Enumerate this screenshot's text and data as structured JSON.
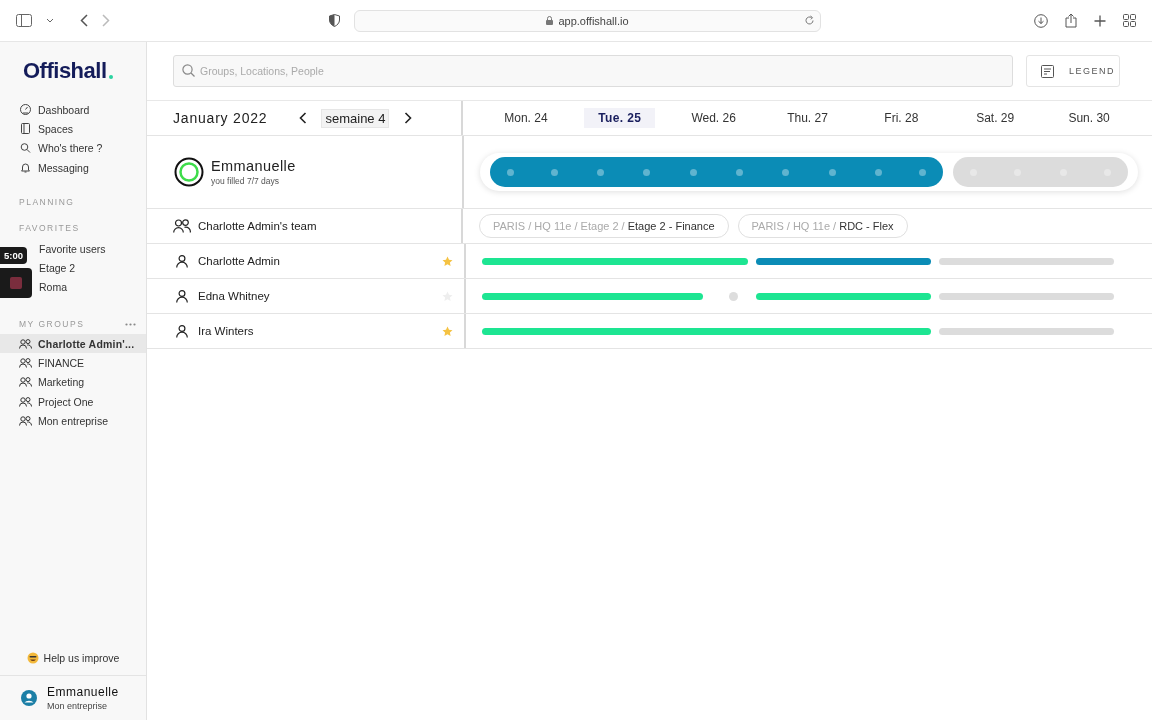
{
  "browser": {
    "url": "app.offishall.io"
  },
  "sidebar": {
    "logo": "Offishall",
    "nav": [
      {
        "label": "Dashboard",
        "kind": "dashboard"
      },
      {
        "label": "Spaces",
        "kind": "spaces"
      },
      {
        "label": "Who's there ?",
        "kind": "search"
      },
      {
        "label": "Messaging",
        "kind": "bell"
      }
    ],
    "planning_heading": "PLANNING",
    "favorites_heading": "FAVORITES",
    "favorites": [
      "Favorite users",
      "Etage 2",
      "Roma"
    ],
    "groups_heading": "MY GROUPS",
    "groups": [
      {
        "label": "Charlotte Admin'...",
        "selected": true
      },
      {
        "label": "FINANCE",
        "selected": false
      },
      {
        "label": "Marketing",
        "selected": false
      },
      {
        "label": "Project One",
        "selected": false
      },
      {
        "label": "Mon entreprise",
        "selected": false
      }
    ],
    "help": "Help us improve",
    "user": {
      "name": "Emmanuelle",
      "company": "Mon entreprise"
    }
  },
  "recorder": {
    "time": "5:00"
  },
  "search": {
    "placeholder": "Groups, Locations, People"
  },
  "legend_button": "LEGEND",
  "calendar": {
    "month": "January 2022",
    "week": "semaine 4",
    "days": [
      {
        "label": "Mon. 24",
        "selected": false
      },
      {
        "label": "Tue. 25",
        "selected": true
      },
      {
        "label": "Wed. 26",
        "selected": false
      },
      {
        "label": "Thu. 27",
        "selected": false
      },
      {
        "label": "Fri. 28",
        "selected": false
      },
      {
        "label": "Sat. 29",
        "selected": false
      },
      {
        "label": "Sun. 30",
        "selected": false
      }
    ],
    "me": {
      "name": "Emmanuelle",
      "filled": "you filled 7/7 days",
      "slots": [
        {
          "kind": "remote"
        },
        {
          "kind": "remote"
        },
        {
          "kind": "remote"
        },
        {
          "kind": "remote"
        },
        {
          "kind": "remote"
        },
        {
          "kind": "remote"
        },
        {
          "kind": "remote"
        },
        {
          "kind": "remote"
        },
        {
          "kind": "remote"
        },
        {
          "kind": "remote"
        },
        {
          "kind": "off"
        },
        {
          "kind": "off"
        },
        {
          "kind": "off"
        },
        {
          "kind": "off"
        }
      ]
    },
    "team": {
      "name": "Charlotte Admin's team",
      "locations": [
        {
          "path": "PARIS / HQ 11e / Etage 2 / ",
          "place": "Etage 2 - Finance"
        },
        {
          "path": "PARIS / HQ 11e / ",
          "place": "RDC - Flex"
        }
      ]
    },
    "people": [
      {
        "name": "Charlotte Admin",
        "favorite": true,
        "slots": [
          {
            "kind": "office"
          },
          {
            "kind": "office"
          },
          {
            "kind": "office"
          },
          {
            "kind": "office"
          },
          {
            "kind": "office"
          },
          {
            "kind": "office"
          },
          {
            "kind": "remote"
          },
          {
            "kind": "remote"
          },
          {
            "kind": "remote"
          },
          {
            "kind": "remote"
          },
          {
            "kind": "off"
          },
          {
            "kind": "off"
          },
          {
            "kind": "off"
          },
          {
            "kind": "off"
          }
        ]
      },
      {
        "name": "Edna Whitney",
        "favorite": false,
        "slots": [
          {
            "kind": "office"
          },
          {
            "kind": "office"
          },
          {
            "kind": "office"
          },
          {
            "kind": "office"
          },
          {
            "kind": "office"
          },
          {
            "kind": "partial"
          },
          {
            "kind": "office"
          },
          {
            "kind": "office"
          },
          {
            "kind": "office"
          },
          {
            "kind": "office"
          },
          {
            "kind": "off"
          },
          {
            "kind": "off"
          },
          {
            "kind": "off"
          },
          {
            "kind": "off"
          }
        ]
      },
      {
        "name": "Ira Winters",
        "favorite": true,
        "slots": [
          {
            "kind": "office"
          },
          {
            "kind": "office"
          },
          {
            "kind": "office"
          },
          {
            "kind": "office"
          },
          {
            "kind": "office"
          },
          {
            "kind": "office"
          },
          {
            "kind": "office"
          },
          {
            "kind": "office"
          },
          {
            "kind": "office"
          },
          {
            "kind": "office"
          },
          {
            "kind": "off"
          },
          {
            "kind": "off"
          },
          {
            "kind": "off"
          },
          {
            "kind": "off"
          }
        ]
      }
    ]
  }
}
